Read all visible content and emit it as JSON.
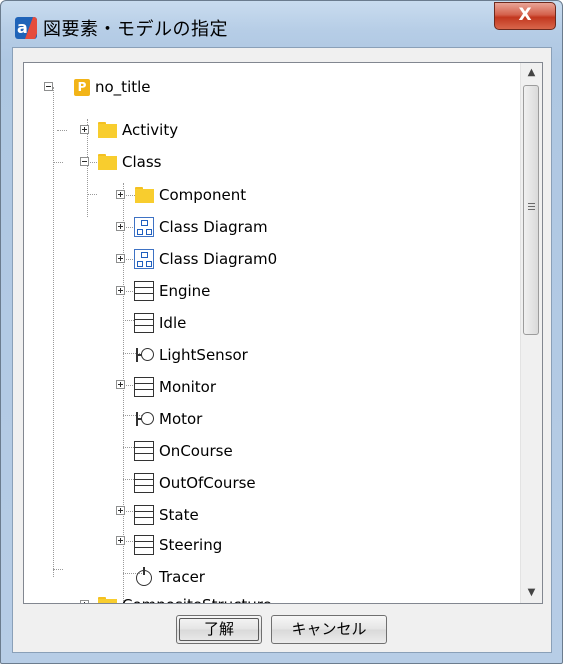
{
  "window": {
    "title": "図要素・モデルの指定",
    "close_label": "X"
  },
  "tree": {
    "nodes": [
      {
        "label": "no_title",
        "icon": "project-icon",
        "project_letter": "P"
      },
      {
        "label": "Activity",
        "icon": "folder-icon"
      },
      {
        "label": "Class",
        "icon": "folder-icon"
      },
      {
        "label": "Component",
        "icon": "folder-icon"
      },
      {
        "label": "Class Diagram",
        "icon": "class-diagram-icon"
      },
      {
        "label": "Class Diagram0",
        "icon": "class-diagram-icon"
      },
      {
        "label": "Engine",
        "icon": "class-icon"
      },
      {
        "label": "Idle",
        "icon": "class-icon"
      },
      {
        "label": "LightSensor",
        "icon": "interface-icon"
      },
      {
        "label": "Monitor",
        "icon": "class-icon"
      },
      {
        "label": "Motor",
        "icon": "interface-icon"
      },
      {
        "label": "OnCourse",
        "icon": "class-icon"
      },
      {
        "label": "OutOfCourse",
        "icon": "class-icon"
      },
      {
        "label": "State",
        "icon": "class-icon"
      },
      {
        "label": "Steering",
        "icon": "class-icon"
      },
      {
        "label": "Tracer",
        "icon": "timer-icon"
      },
      {
        "label": "CompositeStructure",
        "icon": "folder-icon"
      }
    ]
  },
  "buttons": {
    "ok_label": "了解",
    "cancel_label": "キャンセル"
  },
  "colors": {
    "folder": "#f8cd2e",
    "project": "#f2b418",
    "diagram": "#1f5fbf",
    "close_button": "#c2371f"
  }
}
